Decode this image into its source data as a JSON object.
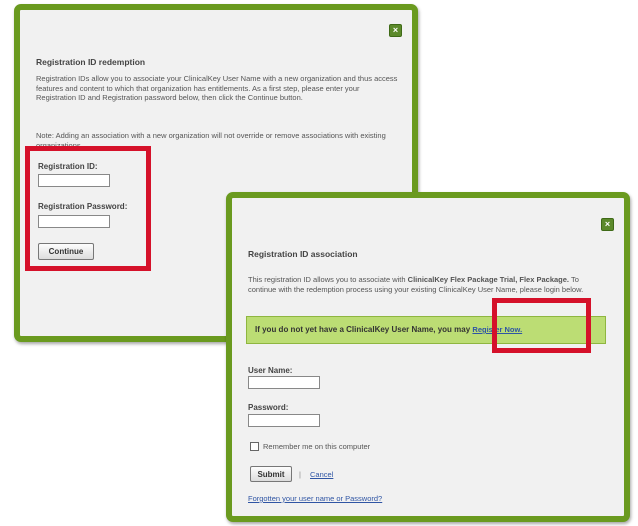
{
  "dialog_redemption": {
    "title": "Registration ID redemption",
    "description": "Registration IDs allow you to associate your ClinicalKey User Name with a new organization and thus access features and content to which that organization has entitlements. As a first step, please enter your Registration ID and Registration password below, then click the Continue button.",
    "note": "Note: Adding an association with a new organization will not override or remove associations with existing organizations.",
    "registration_id_label": "Registration ID:",
    "registration_password_label": "Registration Password:",
    "continue_label": "Continue",
    "close_icon": "close-icon"
  },
  "dialog_association": {
    "title": "Registration ID association",
    "description_prefix": "This registration ID allows you to associate with",
    "description_package": "ClinicalKey Flex Package Trial, Flex Package.",
    "description_suffix": "To continue with the redemption process using your existing ClinicalKey User Name, please login below.",
    "notice_text": "If you do not yet have a ClinicalKey User Name, you may",
    "register_link": "Register Now.",
    "username_label": "User Name:",
    "password_label": "Password:",
    "remember_label": "Remember me on this computer",
    "submit_label": "Submit",
    "separator": "|",
    "cancel_label": "Cancel",
    "forgot_link": "Forgotten your user name or Password?",
    "close_icon": "close-icon"
  },
  "colors": {
    "dialog_border": "#6a9a1f",
    "highlight_box": "#d5112a",
    "notice_background": "#bcdd74"
  }
}
